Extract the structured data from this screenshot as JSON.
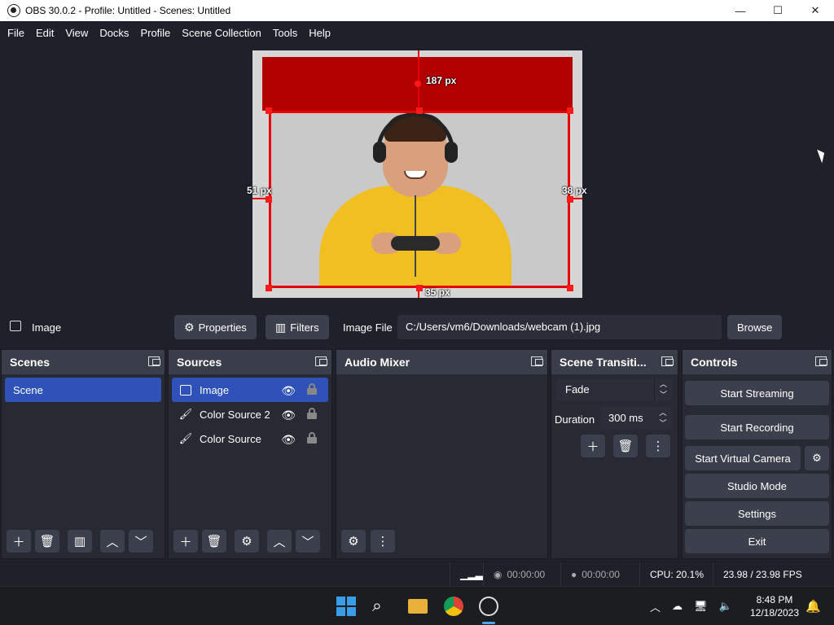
{
  "window": {
    "title": "OBS 30.0.2 - Profile: Untitled - Scenes: Untitled",
    "minimize": "—",
    "maximize": "☐",
    "close": "✕"
  },
  "menu": [
    "File",
    "Edit",
    "View",
    "Docks",
    "Profile",
    "Scene Collection",
    "Tools",
    "Help"
  ],
  "preview": {
    "measure_top": "187 px",
    "measure_left": "51 px",
    "measure_right": "38 px",
    "measure_bottom": "35 px",
    "canvas_bg": "#d6d6d6",
    "color_source_2": "#b30000",
    "selection_color": "#e80000"
  },
  "context": {
    "source_name": "Image",
    "properties_label": "Properties",
    "filters_label": "Filters",
    "image_file_label": "Image File",
    "image_file_path": "C:/Users/vm6/Downloads/webcam (1).jpg",
    "browse_label": "Browse"
  },
  "scenes": {
    "title": "Scenes",
    "items": [
      "Scene"
    ]
  },
  "sources": {
    "title": "Sources",
    "items": [
      {
        "name": "Image",
        "icon": "image-icon"
      },
      {
        "name": "Color Source 2",
        "icon": "brush-icon"
      },
      {
        "name": "Color Source",
        "icon": "brush-icon"
      }
    ]
  },
  "audio_mixer": {
    "title": "Audio Mixer"
  },
  "transitions": {
    "title": "Scene Transiti...",
    "selected": "Fade",
    "duration_label": "Duration",
    "duration_value": "300 ms"
  },
  "controls": {
    "title": "Controls",
    "start_streaming": "Start Streaming",
    "start_recording": "Start Recording",
    "start_virtual_camera": "Start Virtual Camera",
    "studio_mode": "Studio Mode",
    "settings": "Settings",
    "exit": "Exit"
  },
  "status": {
    "stream_time": "00:00:00",
    "record_time": "00:00:00",
    "cpu": "CPU: 20.1%",
    "fps": "23.98 / 23.98 FPS"
  },
  "taskbar": {
    "time": "8:48 PM",
    "date": "12/18/2023",
    "accent": "#3a9de8"
  }
}
